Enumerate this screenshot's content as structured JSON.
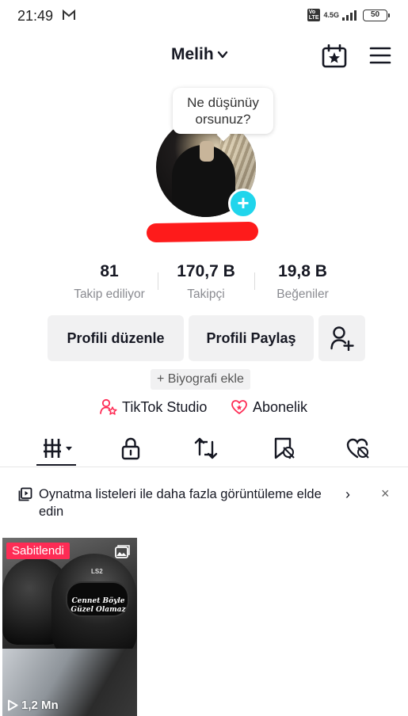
{
  "status_bar": {
    "time": "21:49",
    "network": "4.5G",
    "battery": "50",
    "icons": [
      "gmail-icon",
      "volte-icon",
      "signal-icon",
      "battery-icon"
    ]
  },
  "header": {
    "username": "Melih",
    "icons": [
      "chevron-down-icon",
      "calendar-star-icon",
      "hamburger-menu-icon"
    ]
  },
  "profile": {
    "note_bubble": "Ne düşünüy orsunuz?",
    "add_icon": "plus-icon"
  },
  "stats": [
    {
      "value": "81",
      "label": "Takip ediliyor"
    },
    {
      "value": "170,7 B",
      "label": "Takipçi"
    },
    {
      "value": "19,8 B",
      "label": "Beğeniler"
    }
  ],
  "actions": {
    "edit_profile": "Profili düzenle",
    "share_profile": "Profili Paylaş",
    "add_friend_icon": "add-person-icon"
  },
  "bio": {
    "add_bio": "+ Biyografi ekle"
  },
  "links": {
    "studio": "TikTok Studio",
    "subscription": "Abonelik"
  },
  "tabs": [
    {
      "name": "videos",
      "icon": "grid-icon",
      "selected": true
    },
    {
      "name": "private",
      "icon": "lock-icon"
    },
    {
      "name": "reposts",
      "icon": "repost-icon"
    },
    {
      "name": "favorites",
      "icon": "bookmark-eye-icon"
    },
    {
      "name": "liked",
      "icon": "heart-eye-icon"
    }
  ],
  "banner": {
    "text": "Oynatma listeleri ile daha fazla görüntüleme elde edin",
    "arrow": "›",
    "close": "×"
  },
  "video": {
    "pinned_label": "Sabitlendi",
    "caption": "Cennet Böyle Güzel Olamaz",
    "helmet_logo": "LS2",
    "views": "1,2 Mn"
  },
  "colors": {
    "accent_cyan": "#20d5ec",
    "accent_red": "#fe2c55",
    "button_bg": "#f1f1f2",
    "text_secondary": "#8a8b91"
  }
}
